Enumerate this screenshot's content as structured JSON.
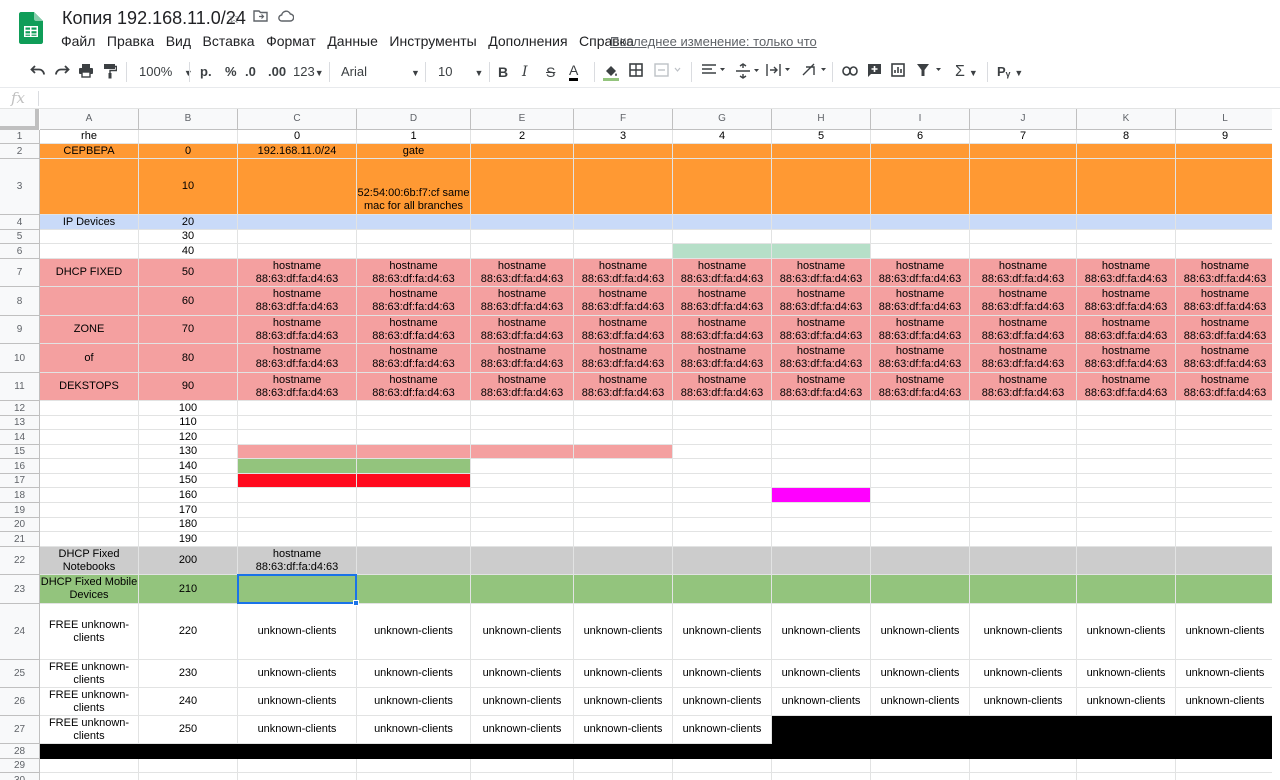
{
  "doc": {
    "title": "Копия 192.168.11.0/24",
    "last_edit": "Последнее изменение: только что"
  },
  "menu": [
    "Файл",
    "Правка",
    "Вид",
    "Вставка",
    "Формат",
    "Данные",
    "Инструменты",
    "Дополнения",
    "Справка"
  ],
  "toolbar": {
    "zoom": "100%",
    "currency": "р.",
    "percent": "%",
    "dec_less": ".0",
    "dec_more": ".00",
    "format_more": "123",
    "font": "Arial",
    "font_size": "10",
    "bold": "B",
    "italic": "I",
    "strike": "S",
    "text_color": "A",
    "input_tools": "Рᵧ"
  },
  "formula": {
    "fx": "fx",
    "value": ""
  },
  "columns": [
    "A",
    "B",
    "C",
    "D",
    "E",
    "F",
    "G",
    "H",
    "I",
    "J",
    "K",
    "L"
  ],
  "rows": [
    {
      "n": "1",
      "cells": [
        "rhe",
        "",
        "0",
        "1",
        "2",
        "3",
        "4",
        "5",
        "6",
        "7",
        "8",
        "9"
      ]
    },
    {
      "n": "2",
      "cells": [
        "СЕРВЕРА",
        "0",
        "192.168.11.0/24",
        "gate",
        "",
        "",
        "",
        "",
        "",
        "",
        "",
        ""
      ]
    },
    {
      "n": "3",
      "cells": [
        "",
        "10",
        "",
        "52:54:00:6b:f7:cf same mac for all branches",
        "",
        "",
        "",
        "",
        "",
        "",
        "",
        ""
      ]
    },
    {
      "n": "4",
      "cells": [
        "IP Devices",
        "20",
        "",
        "",
        "",
        "",
        "",
        "",
        "",
        "",
        "",
        ""
      ]
    },
    {
      "n": "5",
      "cells": [
        "",
        "30",
        "",
        "",
        "",
        "",
        "",
        "",
        "",
        "",
        "",
        ""
      ]
    },
    {
      "n": "6",
      "cells": [
        "",
        "40",
        "",
        "",
        "",
        "",
        "",
        "",
        "",
        "",
        "",
        ""
      ]
    },
    {
      "n": "7",
      "cells": [
        "DHCP FIXED",
        "50",
        "hostname 88:63:df:fa:d4:63",
        "hostname 88:63:df:fa:d4:63",
        "hostname 88:63:df:fa:d4:63",
        "hostname 88:63:df:fa:d4:63",
        "hostname 88:63:df:fa:d4:63",
        "hostname 88:63:df:fa:d4:63",
        "hostname 88:63:df:fa:d4:63",
        "hostname 88:63:df:fa:d4:63",
        "hostname 88:63:df:fa:d4:63",
        "hostname 88:63:df:fa:d4:63"
      ]
    },
    {
      "n": "8",
      "cells": [
        "",
        "60",
        "hostname 88:63:df:fa:d4:63",
        "hostname 88:63:df:fa:d4:63",
        "hostname 88:63:df:fa:d4:63",
        "hostname 88:63:df:fa:d4:63",
        "hostname 88:63:df:fa:d4:63",
        "hostname 88:63:df:fa:d4:63",
        "hostname 88:63:df:fa:d4:63",
        "hostname 88:63:df:fa:d4:63",
        "hostname 88:63:df:fa:d4:63",
        "hostname 88:63:df:fa:d4:63"
      ]
    },
    {
      "n": "9",
      "cells": [
        "ZONE",
        "70",
        "hostname 88:63:df:fa:d4:63",
        "hostname 88:63:df:fa:d4:63",
        "hostname 88:63:df:fa:d4:63",
        "hostname 88:63:df:fa:d4:63",
        "hostname 88:63:df:fa:d4:63",
        "hostname 88:63:df:fa:d4:63",
        "hostname 88:63:df:fa:d4:63",
        "hostname 88:63:df:fa:d4:63",
        "hostname 88:63:df:fa:d4:63",
        "hostname 88:63:df:fa:d4:63"
      ]
    },
    {
      "n": "10",
      "cells": [
        "of",
        "80",
        "hostname 88:63:df:fa:d4:63",
        "hostname 88:63:df:fa:d4:63",
        "hostname 88:63:df:fa:d4:63",
        "hostname 88:63:df:fa:d4:63",
        "hostname 88:63:df:fa:d4:63",
        "hostname 88:63:df:fa:d4:63",
        "hostname 88:63:df:fa:d4:63",
        "hostname 88:63:df:fa:d4:63",
        "hostname 88:63:df:fa:d4:63",
        "hostname 88:63:df:fa:d4:63"
      ]
    },
    {
      "n": "11",
      "cells": [
        "DEKSTOPS",
        "90",
        "hostname 88:63:df:fa:d4:63",
        "hostname 88:63:df:fa:d4:63",
        "hostname 88:63:df:fa:d4:63",
        "hostname 88:63:df:fa:d4:63",
        "hostname 88:63:df:fa:d4:63",
        "hostname 88:63:df:fa:d4:63",
        "hostname 88:63:df:fa:d4:63",
        "hostname 88:63:df:fa:d4:63",
        "hostname 88:63:df:fa:d4:63",
        "hostname 88:63:df:fa:d4:63"
      ]
    },
    {
      "n": "12",
      "cells": [
        "",
        "100",
        "",
        "",
        "",
        "",
        "",
        "",
        "",
        "",
        "",
        ""
      ]
    },
    {
      "n": "13",
      "cells": [
        "",
        "110",
        "",
        "",
        "",
        "",
        "",
        "",
        "",
        "",
        "",
        ""
      ]
    },
    {
      "n": "14",
      "cells": [
        "",
        "120",
        "",
        "",
        "",
        "",
        "",
        "",
        "",
        "",
        "",
        ""
      ]
    },
    {
      "n": "15",
      "cells": [
        "",
        "130",
        "",
        "",
        "",
        "",
        "",
        "",
        "",
        "",
        "",
        ""
      ]
    },
    {
      "n": "16",
      "cells": [
        "",
        "140",
        "",
        "",
        "",
        "",
        "",
        "",
        "",
        "",
        "",
        ""
      ]
    },
    {
      "n": "17",
      "cells": [
        "",
        "150",
        "",
        "",
        "",
        "",
        "",
        "",
        "",
        "",
        "",
        ""
      ]
    },
    {
      "n": "18",
      "cells": [
        "",
        "160",
        "",
        "",
        "",
        "",
        "",
        "",
        "",
        "",
        "",
        ""
      ]
    },
    {
      "n": "19",
      "cells": [
        "",
        "170",
        "",
        "",
        "",
        "",
        "",
        "",
        "",
        "",
        "",
        ""
      ]
    },
    {
      "n": "20",
      "cells": [
        "",
        "180",
        "",
        "",
        "",
        "",
        "",
        "",
        "",
        "",
        "",
        ""
      ]
    },
    {
      "n": "21",
      "cells": [
        "",
        "190",
        "",
        "",
        "",
        "",
        "",
        "",
        "",
        "",
        "",
        ""
      ]
    },
    {
      "n": "22",
      "cells": [
        "DHCP Fixed Notebooks",
        "200",
        "hostname 88:63:df:fa:d4:63",
        "",
        "",
        "",
        "",
        "",
        "",
        "",
        "",
        ""
      ]
    },
    {
      "n": "23",
      "cells": [
        "DHCP Fixed Mobile Devices",
        "210",
        "",
        "",
        "",
        "",
        "",
        "",
        "",
        "",
        "",
        ""
      ]
    },
    {
      "n": "24",
      "cells": [
        "FREE unknown-clients",
        "220",
        "unknown-clients",
        "unknown-clients",
        "unknown-clients",
        "unknown-clients",
        "unknown-clients",
        "unknown-clients",
        "unknown-clients",
        "unknown-clients",
        "unknown-clients",
        "unknown-clients"
      ]
    },
    {
      "n": "25",
      "cells": [
        "FREE unknown-clients",
        "230",
        "unknown-clients",
        "unknown-clients",
        "unknown-clients",
        "unknown-clients",
        "unknown-clients",
        "unknown-clients",
        "unknown-clients",
        "unknown-clients",
        "unknown-clients",
        "unknown-clients"
      ]
    },
    {
      "n": "26",
      "cells": [
        "FREE unknown-clients",
        "240",
        "unknown-clients",
        "unknown-clients",
        "unknown-clients",
        "unknown-clients",
        "unknown-clients",
        "unknown-clients",
        "unknown-clients",
        "unknown-clients",
        "unknown-clients",
        "unknown-clients"
      ]
    },
    {
      "n": "27",
      "cells": [
        "FREE unknown-clients",
        "250",
        "unknown-clients",
        "unknown-clients",
        "unknown-clients",
        "unknown-clients",
        "unknown-clients",
        "",
        "",
        "",
        "",
        ""
      ]
    },
    {
      "n": "28",
      "cells": [
        "",
        "",
        "",
        "",
        "",
        "",
        "",
        "",
        "",
        "",
        "",
        ""
      ]
    },
    {
      "n": "29",
      "cells": [
        "",
        "",
        "",
        "",
        "",
        "",
        "",
        "",
        "",
        "",
        "",
        ""
      ]
    },
    {
      "n": "30",
      "cells": [
        "",
        "",
        "",
        "",
        "",
        "",
        "",
        "",
        "",
        "",
        "",
        ""
      ]
    }
  ],
  "colors": {
    "orange": "#ff9933",
    "blue": "#c9daf8",
    "pink": "#f4a0a0",
    "light_green": "#b6dfc8",
    "green": "#93c47d",
    "red": "#ff0a1e",
    "magenta": "#ff00ff",
    "gray": "#cccccc",
    "black": "#000000",
    "selection": "#1a73e8"
  }
}
